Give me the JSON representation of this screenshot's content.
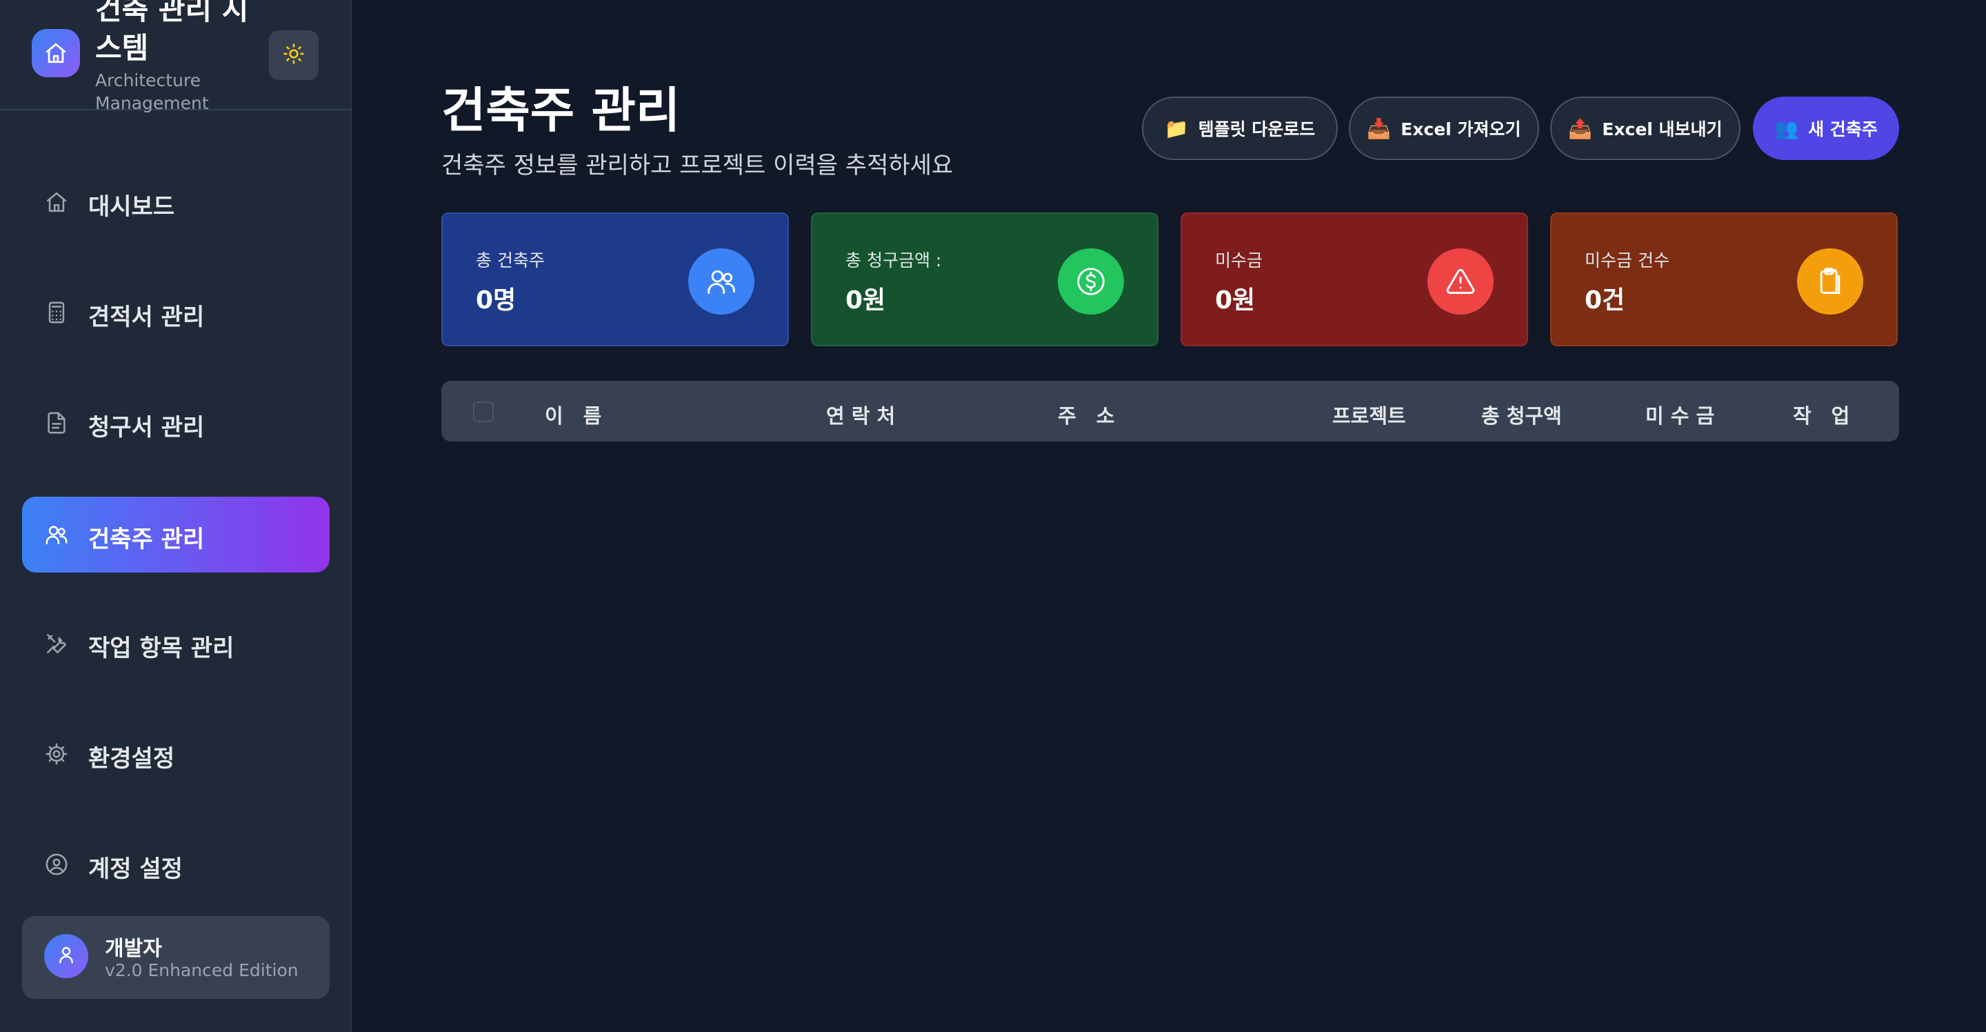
{
  "brand": {
    "title": "건축 관리 시스템",
    "subtitle": "Architecture Management"
  },
  "sidebar": {
    "items": [
      {
        "label": "대시보드",
        "icon": "home-icon",
        "active": false
      },
      {
        "label": "견적서 관리",
        "icon": "calculator-icon",
        "active": false
      },
      {
        "label": "청구서 관리",
        "icon": "document-icon",
        "active": false
      },
      {
        "label": "건축주 관리",
        "icon": "users-icon",
        "active": true
      },
      {
        "label": "작업 항목 관리",
        "icon": "tools-icon",
        "active": false
      },
      {
        "label": "환경설정",
        "icon": "gear-icon",
        "active": false
      },
      {
        "label": "계정 설정",
        "icon": "user-circle-icon",
        "active": false
      }
    ],
    "user": {
      "name": "개발자",
      "version": "v2.0 Enhanced Edition"
    }
  },
  "main": {
    "title": "건축주 관리",
    "subtitle": "건축주 정보를 관리하고 프로젝트 이력을 추적하세요",
    "actions": {
      "template_download": "템플릿 다운로드",
      "excel_import": "Excel 가져오기",
      "excel_export": "Excel 내보내기",
      "new_client": "새 건축주"
    },
    "stats": [
      {
        "label": "총 건축주",
        "value": "0명",
        "icon": "users-icon",
        "color": "#1e3a8a"
      },
      {
        "label": "총 청구금액 :",
        "value": "0원",
        "icon": "dollar-icon",
        "color": "#14532d"
      },
      {
        "label": "미수금",
        "value": "0원",
        "icon": "warning-icon",
        "color": "#7f1d1d"
      },
      {
        "label": "미수금 건수",
        "value": "0건",
        "icon": "clipboard-icon",
        "color": "#7c2d12"
      }
    ],
    "table": {
      "columns": [
        "이　름",
        "연 락 처",
        "주　소",
        "프로젝트",
        "총 청구액",
        "미 수 금",
        "작　업"
      ]
    }
  },
  "colors": {
    "background": "#111827",
    "sidebar": "#1f2937",
    "accent_start": "#3b82f6",
    "accent_end": "#9333ea",
    "primary_button": "#4f46e5"
  }
}
